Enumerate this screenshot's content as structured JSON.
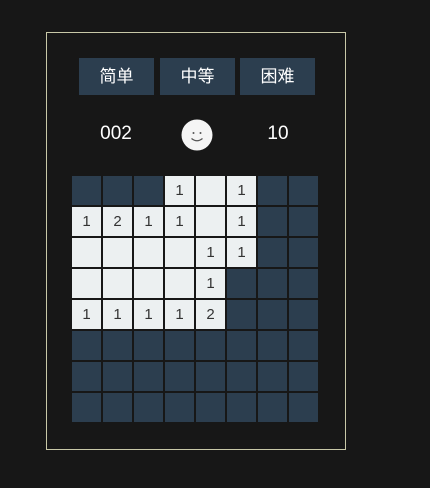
{
  "difficulty": {
    "easy_label": "简单",
    "medium_label": "中等",
    "hard_label": "困难"
  },
  "status": {
    "mines_remaining": "002",
    "timer": "10",
    "face": "smile-face-icon"
  },
  "colors": {
    "hidden_cell": "#2c3e4f",
    "open_cell": "#ecf0f1",
    "background": "#171717",
    "border": "#c8c8a8"
  },
  "board": {
    "rows": 8,
    "cols": 8,
    "cells": [
      [
        "H",
        "H",
        "H",
        "1",
        "",
        "1",
        "H",
        "H"
      ],
      [
        "1",
        "2",
        "1",
        "1",
        "",
        "1",
        "H",
        "H"
      ],
      [
        "",
        "",
        "",
        "",
        "1",
        "1",
        "H",
        "H"
      ],
      [
        "",
        "",
        "",
        "",
        "1",
        "H",
        "H",
        "H"
      ],
      [
        "1",
        "1",
        "1",
        "1",
        "2",
        "H",
        "H",
        "H"
      ],
      [
        "H",
        "H",
        "H",
        "H",
        "H",
        "H",
        "H",
        "H"
      ],
      [
        "H",
        "H",
        "H",
        "H",
        "H",
        "H",
        "H",
        "H"
      ],
      [
        "H",
        "H",
        "H",
        "H",
        "H",
        "H",
        "H",
        "H"
      ]
    ]
  }
}
